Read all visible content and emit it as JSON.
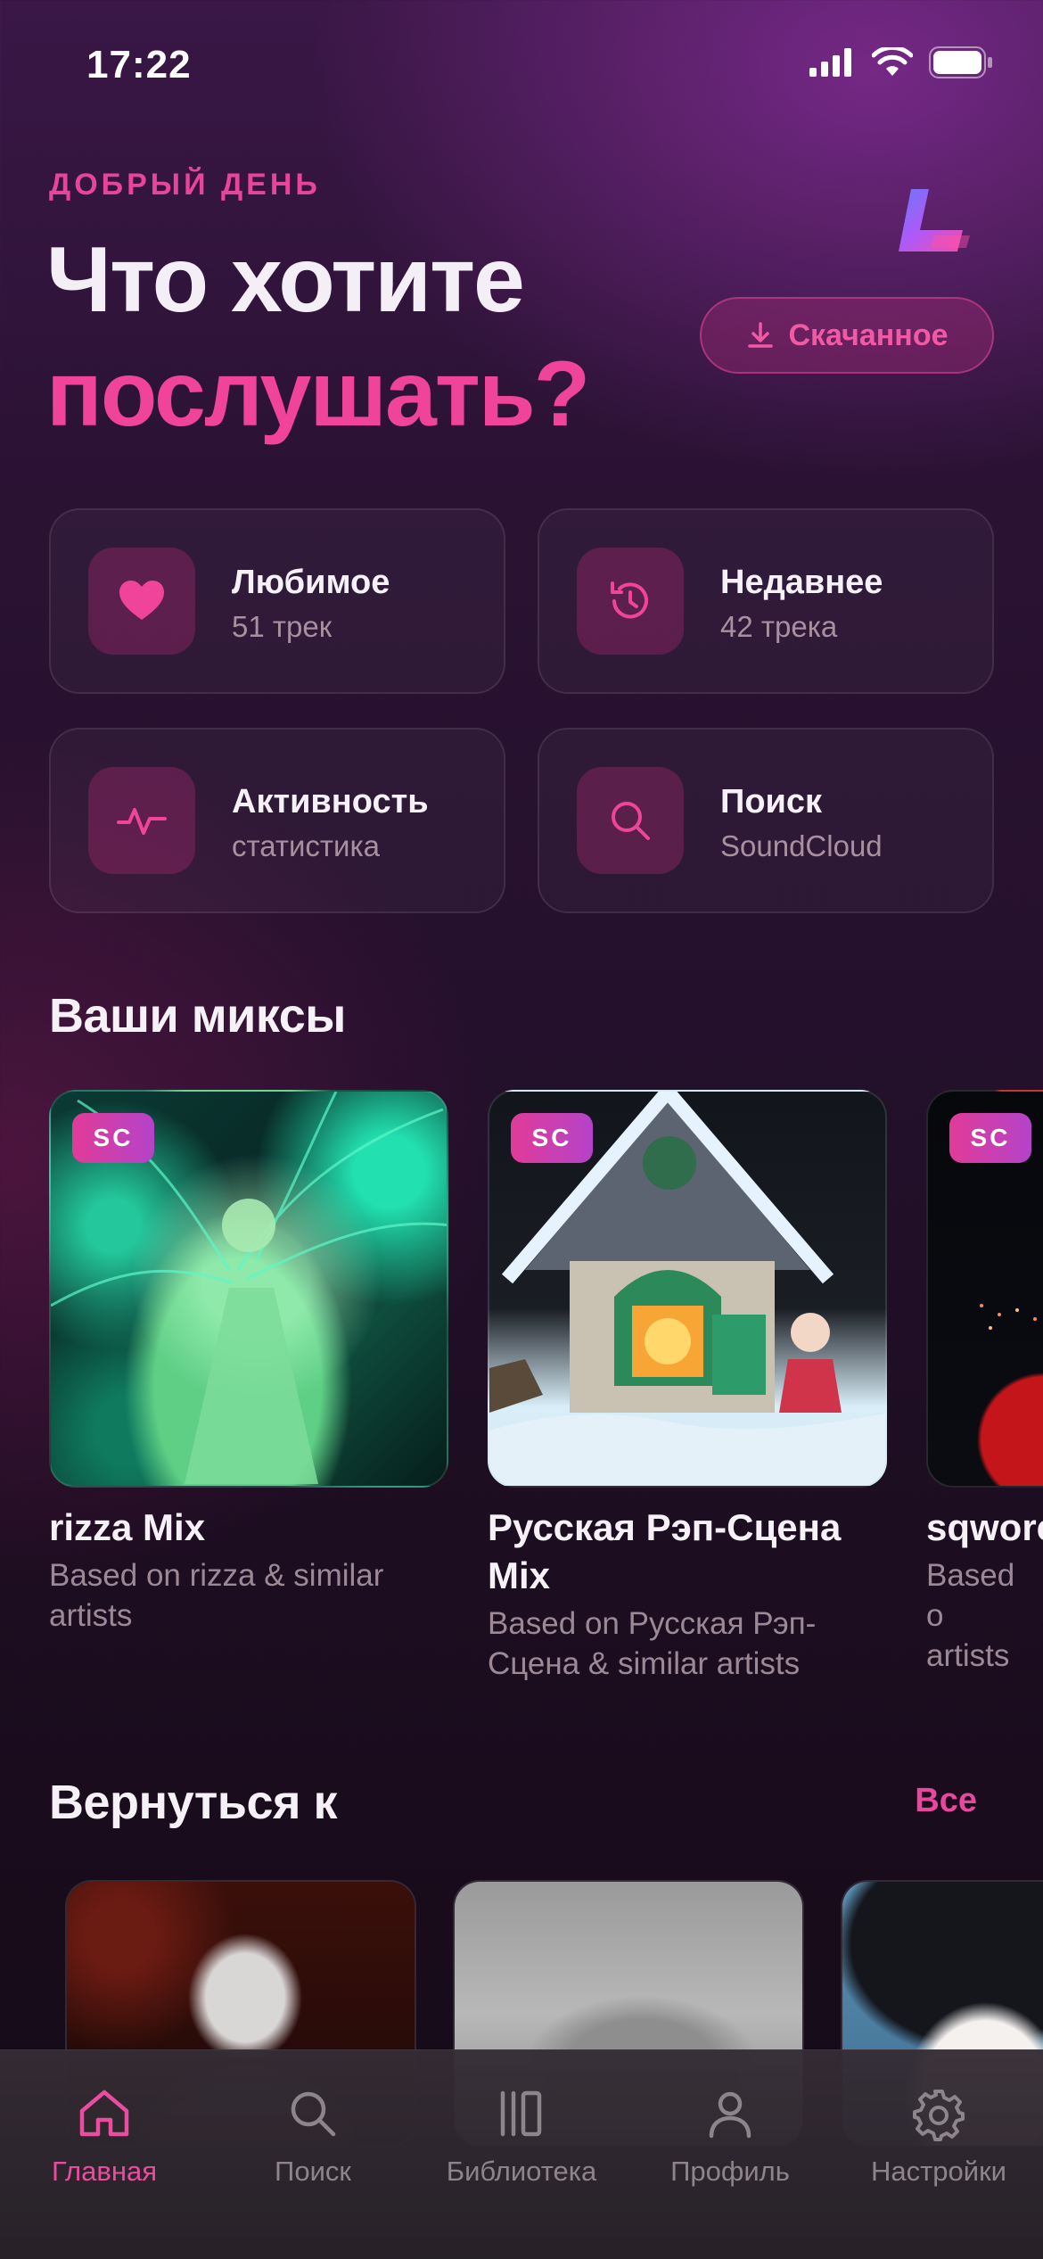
{
  "status_bar": {
    "time": "17:22"
  },
  "header": {
    "greeting": "ДОБРЫЙ ДЕНЬ",
    "title_line1": "Что хотите",
    "title_line2": "послушать?",
    "downloads_button": "Скачанное"
  },
  "quick_cards": [
    {
      "title": "Любимое",
      "subtitle": "51 трек",
      "icon": "heart-icon"
    },
    {
      "title": "Недавнее",
      "subtitle": "42 трека",
      "icon": "history-icon"
    },
    {
      "title": "Активность",
      "subtitle": "статистика",
      "icon": "activity-icon"
    },
    {
      "title": "Поиск",
      "subtitle": "SoundCloud",
      "icon": "search-icon"
    }
  ],
  "mixes": {
    "heading": "Ваши миксы",
    "items": [
      {
        "badge": "SC",
        "name": "rizza Mix",
        "description": "Based on rizza & similar artists"
      },
      {
        "badge": "SC",
        "name": "Русская Рэп-Сцена Mix",
        "description": "Based on Русская Рэп-Сцена & similar artists"
      },
      {
        "badge": "SC",
        "name": "sqwore",
        "description": "Based o artists"
      }
    ]
  },
  "recent": {
    "heading": "Вернуться к",
    "see_all": "Все"
  },
  "tabbar": {
    "items": [
      {
        "label": "Главная",
        "icon": "home-icon",
        "active": true
      },
      {
        "label": "Поиск",
        "icon": "search-icon",
        "active": false
      },
      {
        "label": "Библиотека",
        "icon": "library-icon",
        "active": false
      },
      {
        "label": "Профиль",
        "icon": "profile-icon",
        "active": false
      },
      {
        "label": "Настройки",
        "icon": "settings-icon",
        "active": false
      }
    ]
  },
  "colors": {
    "accent": "#e9479d",
    "background": "#24102c",
    "muted_text": "#9d8996"
  }
}
